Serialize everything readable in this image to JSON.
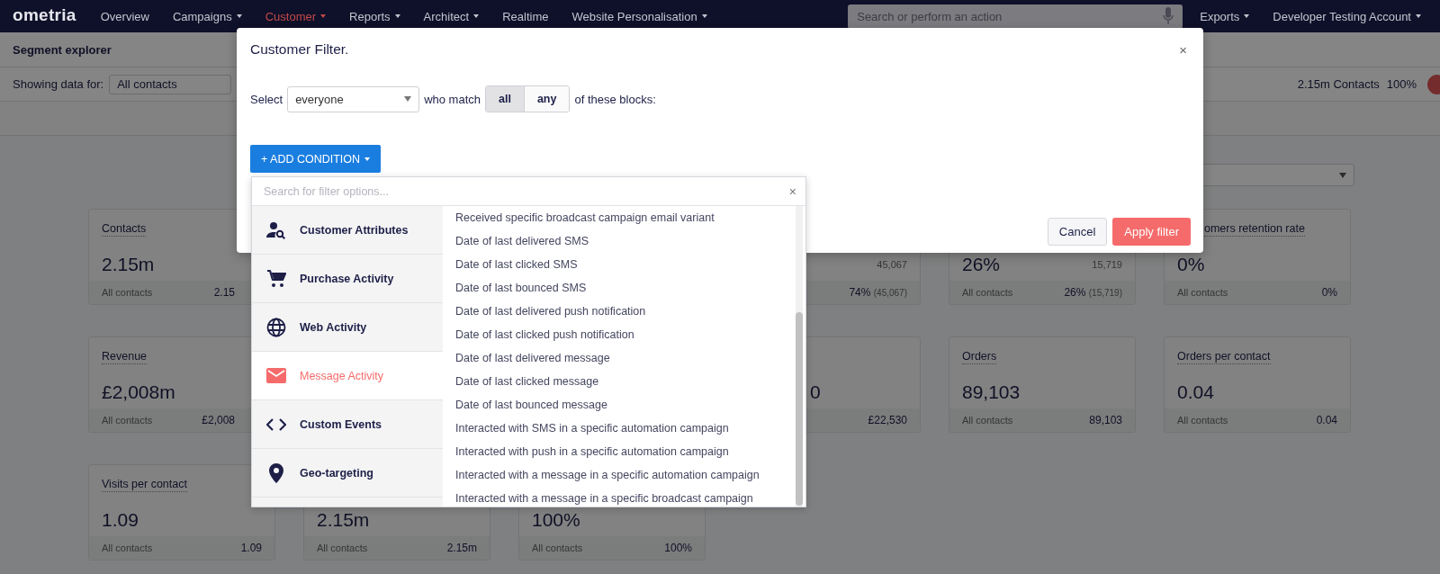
{
  "nav": {
    "logo": "ometria",
    "items": [
      {
        "label": "Overview",
        "selected": false,
        "dropdown": false
      },
      {
        "label": "Campaigns",
        "selected": false,
        "dropdown": true
      },
      {
        "label": "Customer",
        "selected": true,
        "dropdown": true
      },
      {
        "label": "Reports",
        "selected": false,
        "dropdown": true
      },
      {
        "label": "Architect",
        "selected": false,
        "dropdown": true
      },
      {
        "label": "Realtime",
        "selected": false,
        "dropdown": false
      },
      {
        "label": "Website Personalisation",
        "selected": false,
        "dropdown": true
      }
    ],
    "search": {
      "placeholder": "Search or perform an action"
    },
    "right_items": [
      {
        "label": "Exports",
        "dropdown": true
      },
      {
        "label": "Developer Testing Account",
        "dropdown": true
      }
    ]
  },
  "page": {
    "title": "Segment explorer",
    "filter": {
      "label": "Showing data for:",
      "value": "All contacts"
    },
    "summary": {
      "contacts": "2.15m Contacts",
      "percent": "100%"
    }
  },
  "cards": [
    [
      {
        "title": "Contacts",
        "value": "2.15m",
        "footer_label": "All contacts",
        "footer_value": "2.15"
      },
      {
        "sub": "45,067",
        "footer_value": "74%",
        "footer_note": "(45,067)"
      },
      {
        "value": "26%",
        "sub": "15,719",
        "footer_label": "All contacts",
        "footer_value": "26%",
        "footer_note": "(15,719)"
      },
      {
        "title": "omers retention rate",
        "value": "0%",
        "footer_label": "All contacts",
        "footer_value": "0%"
      }
    ],
    [
      {
        "title": "Revenue",
        "value": "£2,008m",
        "footer_label": "All contacts",
        "footer_value": "£2,008"
      },
      {
        "value": "0",
        "footer_value": "£22,530"
      },
      {
        "title": "Orders",
        "value": "89,103",
        "footer_label": "All contacts",
        "footer_value": "89,103"
      },
      {
        "title": "Orders per contact",
        "value": "0.04",
        "footer_label": "All contacts",
        "footer_value": "0.04"
      }
    ],
    [
      {
        "title": "Visits per contact",
        "value": "1.09",
        "footer_label": "All contacts",
        "footer_value": "1.09"
      },
      {
        "value": "2.15m",
        "footer_label": "All contacts",
        "footer_value": "2.15m"
      },
      {
        "value": "100%",
        "footer_label": "All contacts",
        "footer_value": "100%"
      }
    ]
  ],
  "modal": {
    "title": "Customer Filter.",
    "close": "×",
    "select_label": "Select",
    "select_value": "everyone",
    "match_label": "who match",
    "match_options": [
      {
        "label": "all",
        "selected": true
      },
      {
        "label": "any",
        "selected": false
      }
    ],
    "suffix": "of these blocks:",
    "add_button": "+ ADD CONDITION",
    "cancel": "Cancel",
    "apply": "Apply filter"
  },
  "condition_menu": {
    "search_placeholder": "Search for filter options...",
    "close": "×",
    "categories": [
      {
        "label": "Customer Attributes",
        "selected": false
      },
      {
        "label": "Purchase Activity",
        "selected": false
      },
      {
        "label": "Web Activity",
        "selected": false
      },
      {
        "label": "Message Activity",
        "selected": true
      },
      {
        "label": "Custom Events",
        "selected": false
      },
      {
        "label": "Geo-targeting",
        "selected": false
      }
    ],
    "options": [
      "Received specific broadcast campaign email variant",
      "Date of last delivered SMS",
      "Date of last clicked SMS",
      "Date of last bounced SMS",
      "Date of last delivered push notification",
      "Date of last clicked push notification",
      "Date of last delivered message",
      "Date of last clicked message",
      "Date of last bounced message",
      "Interacted with SMS in a specific automation campaign",
      "Interacted with push in a specific automation campaign",
      "Interacted with a message in a specific automation campaign",
      "Interacted with a message in a specific broadcast campaign"
    ]
  }
}
